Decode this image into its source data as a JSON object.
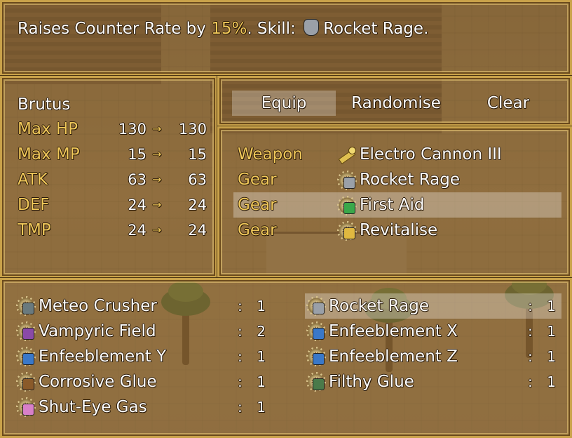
{
  "help": {
    "prefix": "Raises Counter Rate by ",
    "rate": "15%",
    "middle": ". Skill: ",
    "skill_icon": "rocket-rage-icon",
    "skill": "Rocket Rage",
    "suffix": "."
  },
  "status": {
    "actor_name": "Brutus",
    "arrow": "→",
    "stats": [
      {
        "label": "Max HP",
        "current": "130",
        "new": "130"
      },
      {
        "label": "Max MP",
        "current": "15",
        "new": "15"
      },
      {
        "label": "ATK",
        "current": "63",
        "new": "63"
      },
      {
        "label": "DEF",
        "current": "24",
        "new": "24"
      },
      {
        "label": "TMP",
        "current": "24",
        "new": "24"
      }
    ]
  },
  "commands": {
    "equip": "Equip",
    "randomise": "Randomise",
    "clear": "Clear",
    "selected": "Equip"
  },
  "slots": [
    {
      "type": "Weapon",
      "icon": "cannon-icon",
      "item": "Electro Cannon III"
    },
    {
      "type": "Gear",
      "icon": "rocket-rage-icon",
      "item": "Rocket Rage"
    },
    {
      "type": "Gear",
      "icon": "first-aid-icon",
      "item": "First Aid",
      "selected": true
    },
    {
      "type": "Gear",
      "icon": "revitalise-icon",
      "item": "Revitalise"
    }
  ],
  "inventory": {
    "separator": ":",
    "items": [
      {
        "name": "Meteo Crusher",
        "qty": "1",
        "icon": "meteo-crusher-icon",
        "color": "#6a7a7e"
      },
      {
        "name": "Vampyric Field",
        "qty": "2",
        "icon": "vampyric-field-icon",
        "color": "#8a4aa8"
      },
      {
        "name": "Enfeeblement Y",
        "qty": "1",
        "icon": "enfeeblement-y-icon",
        "color": "#3a78c8"
      },
      {
        "name": "Corrosive Glue",
        "qty": "1",
        "icon": "corrosive-glue-icon",
        "color": "#8a5a2a"
      },
      {
        "name": "Shut-Eye Gas",
        "qty": "1",
        "icon": "shut-eye-gas-icon",
        "color": "#d880c8"
      },
      {
        "name": "Rocket Rage",
        "qty": "1",
        "icon": "rocket-rage-icon",
        "color": "#9aa0a8",
        "selected": true
      },
      {
        "name": "Enfeeblement X",
        "qty": "1",
        "icon": "enfeeblement-x-icon",
        "color": "#3a78c8"
      },
      {
        "name": "Enfeeblement Z",
        "qty": "1",
        "icon": "enfeeblement-z-icon",
        "color": "#3a78c8"
      },
      {
        "name": "Filthy Glue",
        "qty": "1",
        "icon": "filthy-glue-icon",
        "color": "#4a7a4a"
      }
    ]
  },
  "colors": {
    "system_text": "#f0c85a",
    "window_border": "#c9a24a",
    "cursor": "rgba(255,255,255,0.30)"
  }
}
